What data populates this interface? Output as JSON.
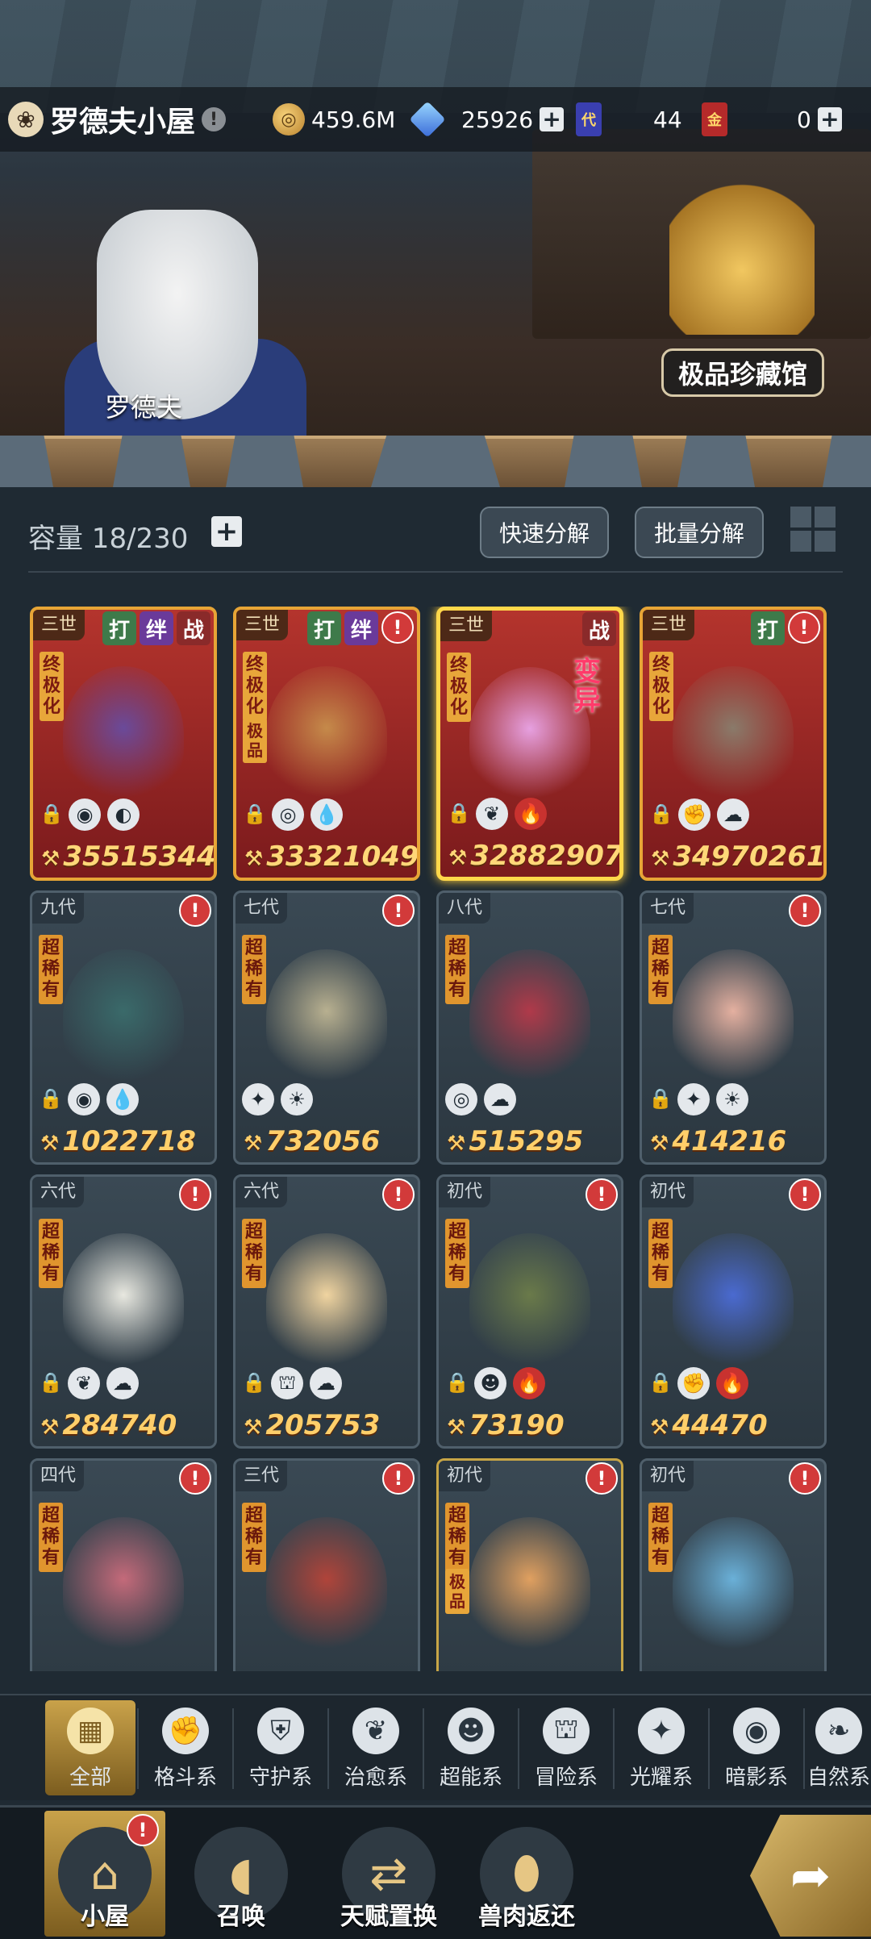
{
  "header": {
    "home_title": "罗德夫小屋",
    "alert_mark": "!",
    "resources": [
      {
        "name": "gold",
        "value": "459.6M"
      },
      {
        "name": "diamond",
        "value": "25926"
      },
      {
        "name": "generation-card",
        "icon_text": "代",
        "value": "44"
      },
      {
        "name": "gold-card",
        "icon_text": "金",
        "value": "0"
      }
    ],
    "plus": "+"
  },
  "scene": {
    "npc_name": "罗德夫",
    "museum_label": "极品珍藏馆"
  },
  "inventory": {
    "capacity_label": "容量 18/230",
    "plus": "+",
    "quick_decompose": "快速分解",
    "batch_decompose": "批量分解"
  },
  "cards": [
    {
      "gen": "三世",
      "tags": [
        "打",
        "绊",
        "战"
      ],
      "side": "终极化",
      "power": "35515344",
      "attrs": [
        "◉",
        "◐"
      ],
      "locked": true,
      "style": "gold"
    },
    {
      "gen": "三世",
      "tags": [
        "打",
        "绊"
      ],
      "warn": true,
      "side": "终极化",
      "side2": "极品",
      "power": "33321049",
      "attrs": [
        "◎",
        "💧"
      ],
      "locked": true,
      "style": "gold"
    },
    {
      "gen": "三世",
      "tags": [
        "战"
      ],
      "side": "终极化",
      "mutate": "变异",
      "power": "32882907",
      "attrs": [
        "❦",
        "🔥"
      ],
      "locked": true,
      "style": "gold-sel"
    },
    {
      "gen": "三世",
      "tags": [
        "打"
      ],
      "warn": true,
      "side": "终极化",
      "power": "34970261",
      "attrs": [
        "✊",
        "☁"
      ],
      "locked": true,
      "style": "gold"
    },
    {
      "gen": "九代",
      "warn": true,
      "side": "超稀有",
      "power": "1022718",
      "attrs": [
        "◉",
        "💧"
      ],
      "locked": true,
      "style": "norm"
    },
    {
      "gen": "七代",
      "warn": true,
      "side": "超稀有",
      "power": "732056",
      "attrs": [
        "✦",
        "☀"
      ],
      "locked": false,
      "style": "norm"
    },
    {
      "gen": "八代",
      "warn": false,
      "side": "超稀有",
      "power": "515295",
      "attrs": [
        "◎",
        "☁"
      ],
      "locked": false,
      "style": "norm"
    },
    {
      "gen": "七代",
      "warn": true,
      "side": "超稀有",
      "power": "414216",
      "attrs": [
        "✦",
        "☀"
      ],
      "locked": true,
      "style": "norm"
    },
    {
      "gen": "六代",
      "warn": true,
      "side": "超稀有",
      "power": "284740",
      "attrs": [
        "❦",
        "☁"
      ],
      "locked": true,
      "style": "norm"
    },
    {
      "gen": "六代",
      "warn": true,
      "side": "超稀有",
      "power": "205753",
      "attrs": [
        "⛫",
        "☁"
      ],
      "locked": true,
      "style": "norm"
    },
    {
      "gen": "初代",
      "warn": true,
      "side": "超稀有",
      "power": "73190",
      "attrs": [
        "☻",
        "🔥"
      ],
      "locked": true,
      "style": "norm"
    },
    {
      "gen": "初代",
      "warn": true,
      "side": "超稀有",
      "power": "44470",
      "attrs": [
        "✊",
        "🔥"
      ],
      "locked": true,
      "style": "norm"
    },
    {
      "gen": "四代",
      "warn": true,
      "side": "超稀有",
      "power": "",
      "attrs": [],
      "locked": false,
      "style": "norm"
    },
    {
      "gen": "三代",
      "warn": true,
      "side": "超稀有",
      "power": "",
      "attrs": [],
      "locked": false,
      "style": "norm"
    },
    {
      "gen": "初代",
      "warn": true,
      "side": "超稀有",
      "side2": "极品",
      "power": "",
      "attrs": [],
      "locked": false,
      "style": "norm-glow"
    },
    {
      "gen": "初代",
      "warn": true,
      "side": "超稀有",
      "power": "",
      "attrs": [],
      "locked": false,
      "style": "norm"
    }
  ],
  "filter_tabs": [
    {
      "label": "全部",
      "icon": "grid-icon",
      "glyph": "▦",
      "active": true
    },
    {
      "label": "格斗系",
      "icon": "fist-icon",
      "glyph": "✊"
    },
    {
      "label": "守护系",
      "icon": "shield-icon",
      "glyph": "⛨"
    },
    {
      "label": "治愈系",
      "icon": "sprout-icon",
      "glyph": "❦"
    },
    {
      "label": "超能系",
      "icon": "alien-icon",
      "glyph": "☻"
    },
    {
      "label": "冒险系",
      "icon": "lantern-icon",
      "glyph": "⛫"
    },
    {
      "label": "光耀系",
      "icon": "sparkle-icon",
      "glyph": "✦"
    },
    {
      "label": "暗影系",
      "icon": "eye-icon",
      "glyph": "◉"
    },
    {
      "label": "自然系",
      "icon": "leaf-icon",
      "glyph": "❧"
    }
  ],
  "nav": [
    {
      "label": "小屋",
      "icon": "house-icon",
      "glyph": "⌂",
      "active": true,
      "badge": "!"
    },
    {
      "label": "召唤",
      "icon": "egg-icon",
      "glyph": "◖"
    },
    {
      "label": "天赋置换",
      "icon": "swap-icon",
      "glyph": "⇄"
    },
    {
      "label": "兽肉返还",
      "icon": "meat-icon",
      "glyph": "⬮"
    }
  ],
  "colors": {
    "accent": "#c9a24a",
    "alert": "#d23a3a",
    "gold_frame": "#e7a536"
  }
}
